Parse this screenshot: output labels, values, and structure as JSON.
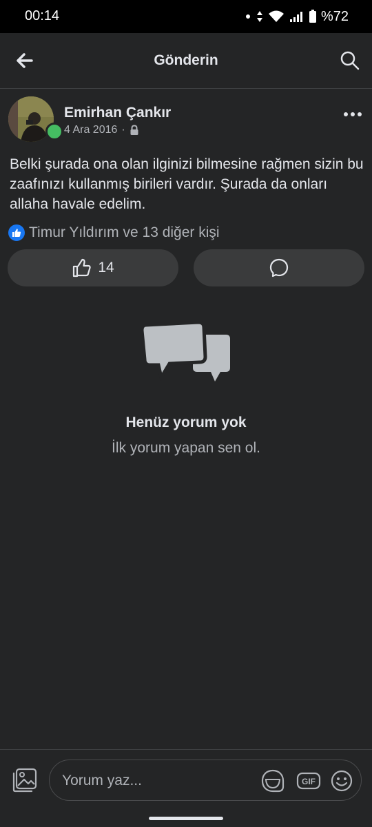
{
  "status_bar": {
    "time": "00:14",
    "battery": "%72"
  },
  "app_bar": {
    "title": "Gönderin"
  },
  "post": {
    "author": "Emirhan Çankır",
    "date": "4 Ara 2016",
    "separator": "·",
    "text": "Belki şurada ona olan ilginizi bilmesine rağmen sizin bu zaafınızı kullanmış birileri vardır. Şurada da onları allaha havale edelim.",
    "reactions_summary": "Timur Yıldırım ve 13 diğer kişi",
    "like_count": "14"
  },
  "empty_state": {
    "title": "Henüz yorum yok",
    "subtitle": "İlk yorum yapan sen ol."
  },
  "composer": {
    "placeholder": "Yorum yaz..."
  },
  "colors": {
    "background": "#242526",
    "button_bg": "#3a3b3c",
    "accent_blue": "#1877f2",
    "online_green": "#45bd62",
    "secondary_text": "#b0b3b8"
  },
  "icons": [
    "back-arrow-icon",
    "search-icon",
    "more-icon",
    "lock-icon",
    "like-reaction-icon",
    "thumbs-up-icon",
    "comment-icon",
    "chat-bubbles-icon",
    "photo-icon",
    "sticker-icon",
    "gif-icon",
    "emoji-icon"
  ]
}
